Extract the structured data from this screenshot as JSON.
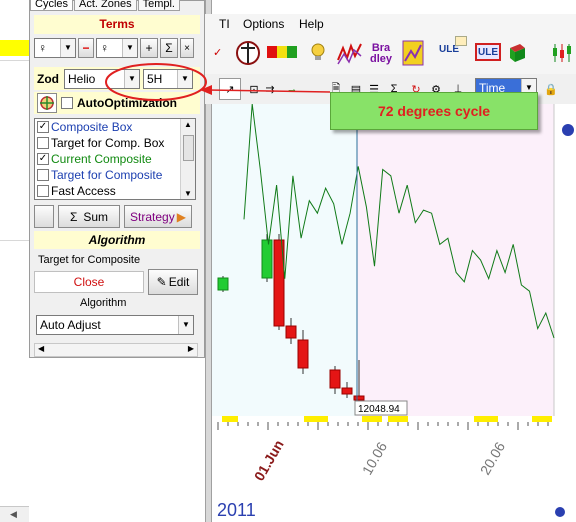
{
  "panel": {
    "tabs": [
      "Cycles",
      "Act. Zones",
      "Templ."
    ],
    "terms_title": "Terms",
    "planet1": "♀",
    "planet2": "♀",
    "minus": "−",
    "add": "+",
    "sigma": "Σ",
    "times": "×",
    "zod_label": "Zod",
    "zod_value": "Helio",
    "interval_value": "5H",
    "auto_optimization": "AutoOptimization",
    "list_items": [
      {
        "label": "Composite Box",
        "checked": true,
        "color": "#1c3fb0"
      },
      {
        "label": "Target for Comp. Box",
        "checked": false,
        "color": "#000000"
      },
      {
        "label": "Current Composite",
        "checked": true,
        "color": "#118a11"
      },
      {
        "label": "Target for Composite",
        "checked": false,
        "color": "#1c3fb0"
      },
      {
        "label": "Fast Access",
        "checked": false,
        "color": "#000000"
      }
    ],
    "sum_label": "Sum",
    "strategy_label": "Strategy",
    "algorithm_title": "Algorithm",
    "target_for_composite": "Target for Composite",
    "close_label": "Close",
    "edit_label": "Edit",
    "algorithm_label": "Algorithm",
    "algorithm_value": "Auto Adjust"
  },
  "menu": {
    "items": [
      "TI",
      "Options",
      "Help"
    ]
  },
  "toolbar": {
    "bradley_label": "Bra dley",
    "ule_label": "ULE",
    "ule2_label": "ULE",
    "time_label": "Time"
  },
  "callout": {
    "text": "72 degrees cycle"
  },
  "chart_data": {
    "type": "candlestick+line",
    "price_label": "12048.94",
    "x_tick_labels": [
      "01.Jun",
      "10.06",
      "20.06"
    ],
    "year_label": "2011",
    "composite_line_y_relative": [
      0.37,
      0.0,
      0.21,
      0.45,
      0.26,
      0.56,
      0.23,
      0.43,
      0.31,
      0.35,
      0.27,
      0.32,
      0.45,
      0.35,
      0.2,
      0.33,
      0.52,
      0.21,
      0.23,
      0.35,
      0.26,
      0.38,
      0.34,
      0.35,
      0.45,
      0.43,
      0.54,
      0.57,
      0.47,
      0.5,
      0.56,
      0.47,
      0.54,
      0.45,
      0.58,
      0.6,
      0.72,
      0.67,
      0.75
    ]
  }
}
